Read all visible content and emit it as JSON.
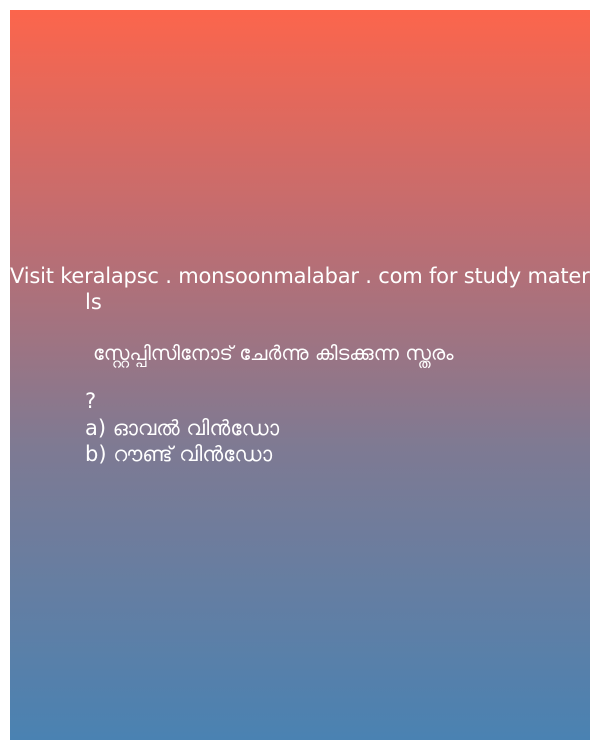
{
  "promo": {
    "line1": "Visit keralapsc . monsoonmalabar . com for study materia",
    "line2": "ls"
  },
  "question": {
    "text": "സ്റ്റേപ്പിസിനോട് ചേർന്നു കിടക്കുന്ന സ്തരം",
    "mark": "?"
  },
  "options": [
    {
      "label": "a) ഓവൽ വിൻഡോ"
    },
    {
      "label": "b) റൗണ്ട് വിൻഡോ"
    }
  ],
  "colors": {
    "gradient_top": "#fc654c",
    "gradient_bottom": "#4a82b2",
    "text": "#ffffff"
  }
}
